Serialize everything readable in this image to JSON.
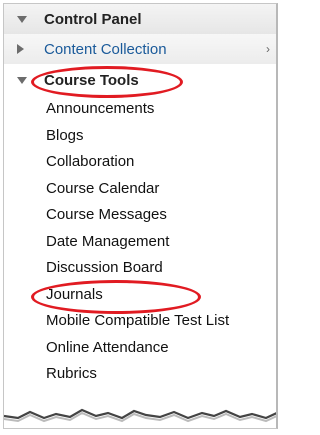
{
  "control_panel": {
    "title": "Control Panel",
    "icon": "triangle-down-icon"
  },
  "content_collection": {
    "label": "Content Collection",
    "icon": "triangle-right-icon",
    "chevron": "›"
  },
  "course_tools": {
    "title": "Course Tools",
    "icon": "triangle-down-icon",
    "items": [
      "Announcements",
      "Blogs",
      "Collaboration",
      "Course Calendar",
      "Course Messages",
      "Date Management",
      "Discussion Board",
      "Journals",
      "Mobile Compatible Test List",
      "Online Attendance",
      "Rubrics"
    ]
  },
  "annotation_color": "#e11b22"
}
